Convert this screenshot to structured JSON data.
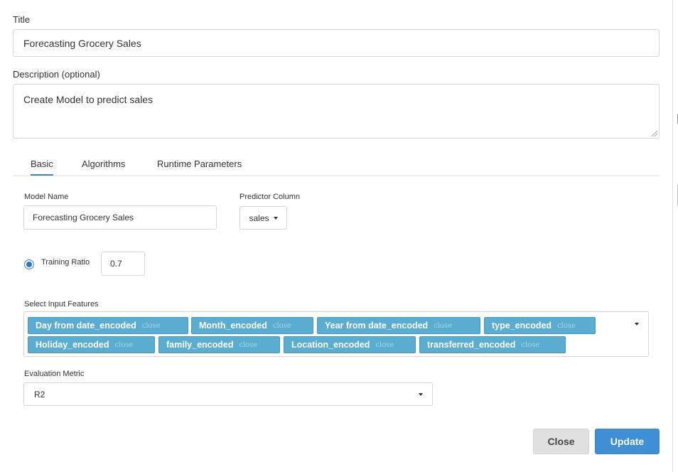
{
  "form": {
    "title_label": "Title",
    "title_value": "Forecasting  Grocery Sales",
    "description_label": "Description (optional)",
    "description_value": "Create Model to predict sales"
  },
  "tabs": [
    {
      "label": "Basic",
      "active": true
    },
    {
      "label": "Algorithms",
      "active": false
    },
    {
      "label": "Runtime Parameters",
      "active": false
    }
  ],
  "basic": {
    "model_name_label": "Model Name",
    "model_name_value": "Forecasting  Grocery Sales",
    "predictor_label": "Predictor Column",
    "predictor_value": "sales",
    "training_ratio_label": "Training Ratio",
    "training_ratio_value": "0.7",
    "features_label": "Select Input Features",
    "features": [
      {
        "name": "Day from date_encoded",
        "close": "close"
      },
      {
        "name": "Month_encoded",
        "close": "close"
      },
      {
        "name": "Year from date_encoded",
        "close": "close"
      },
      {
        "name": "type_encoded",
        "close": "close"
      },
      {
        "name": "Holiday_encoded",
        "close": "close"
      },
      {
        "name": "family_encoded",
        "close": "close"
      },
      {
        "name": "Location_encoded",
        "close": "close"
      },
      {
        "name": "transferred_encoded",
        "close": "close"
      }
    ],
    "metric_label": "Evaluation Metric",
    "metric_value": "R2"
  },
  "footer": {
    "close_label": "Close",
    "update_label": "Update"
  },
  "colors": {
    "accent": "#3f8fd6",
    "chip": "#5aacd0"
  }
}
